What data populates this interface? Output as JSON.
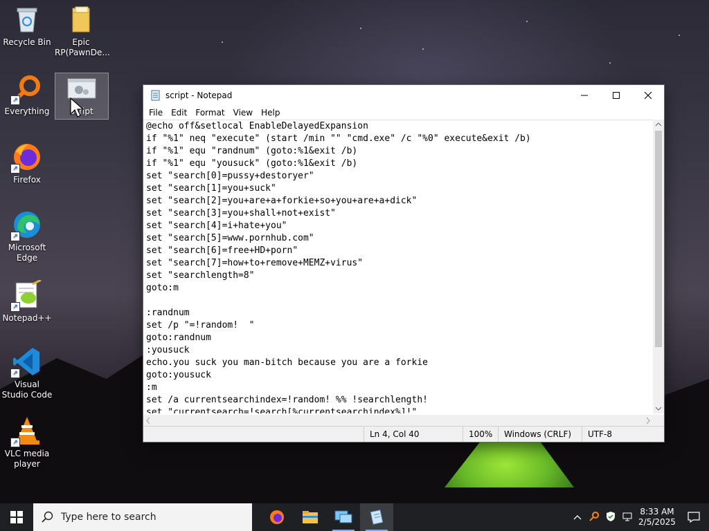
{
  "desktop": {
    "icons": [
      {
        "label": "Recycle Bin",
        "icon": "recycle-bin-icon"
      },
      {
        "label": "Epic RP(PawnDe...",
        "icon": "folder-icon"
      },
      {
        "label": "Everything",
        "icon": "everything-search-icon"
      },
      {
        "label": "script",
        "icon": "batch-script-icon"
      },
      {
        "label": "Firefox",
        "icon": "firefox-icon"
      },
      {
        "label": "Microsoft Edge",
        "icon": "edge-icon"
      },
      {
        "label": "Notepad++",
        "icon": "notepad-plus-plus-icon"
      },
      {
        "label": "Visual Studio Code",
        "icon": "vscode-icon"
      },
      {
        "label": "VLC media player",
        "icon": "vlc-icon"
      }
    ]
  },
  "notepad": {
    "title": "script - Notepad",
    "menu": [
      "File",
      "Edit",
      "Format",
      "View",
      "Help"
    ],
    "lines": [
      "@echo off&setlocal EnableDelayedExpansion",
      "if \"%1\" neq \"execute\" (start /min \"\" \"cmd.exe\" /c \"%0\" execute&exit /b)",
      "if \"%1\" equ \"randnum\" (goto:%1&exit /b)",
      "if \"%1\" equ \"yousuck\" (goto:%1&exit /b)",
      "set \"search[0]=pussy+destoryer\"",
      "set \"search[1]=you+suck\"",
      "set \"search[2]=you+are+a+forkie+so+you+are+a+dick\"",
      "set \"search[3]=you+shall+not+exist\"",
      "set \"search[4]=i+hate+you\"",
      "set \"search[5]=www.pornhub.com\"",
      "set \"search[6]=free+HD+porn\"",
      "set \"search[7]=how+to+remove+MEMZ+virus\"",
      "set \"searchlength=8\"",
      "goto:m",
      "",
      ":randnum",
      "set /p \"=!random!  \"",
      "goto:randnum",
      ":yousuck",
      "echo.you suck you man-bitch because you are a forkie",
      "goto:yousuck",
      ":m",
      "set /a currentsearchindex=!random! %% !searchlength!",
      "set \"currentsearch=!search[%currentsearchindex%]!\""
    ],
    "status": {
      "position": "Ln 4, Col 40",
      "zoom": "100%",
      "line_ending": "Windows (CRLF)",
      "encoding": "UTF-8"
    }
  },
  "taskbar": {
    "search_placeholder": "Type here to search",
    "apps": [
      "firefox-icon",
      "file-explorer-icon",
      "remote-desktop-icon",
      "notepad-icon"
    ],
    "active_app": "notepad-icon",
    "clock_time": "8:33 AM",
    "clock_date": "2/5/2025"
  }
}
